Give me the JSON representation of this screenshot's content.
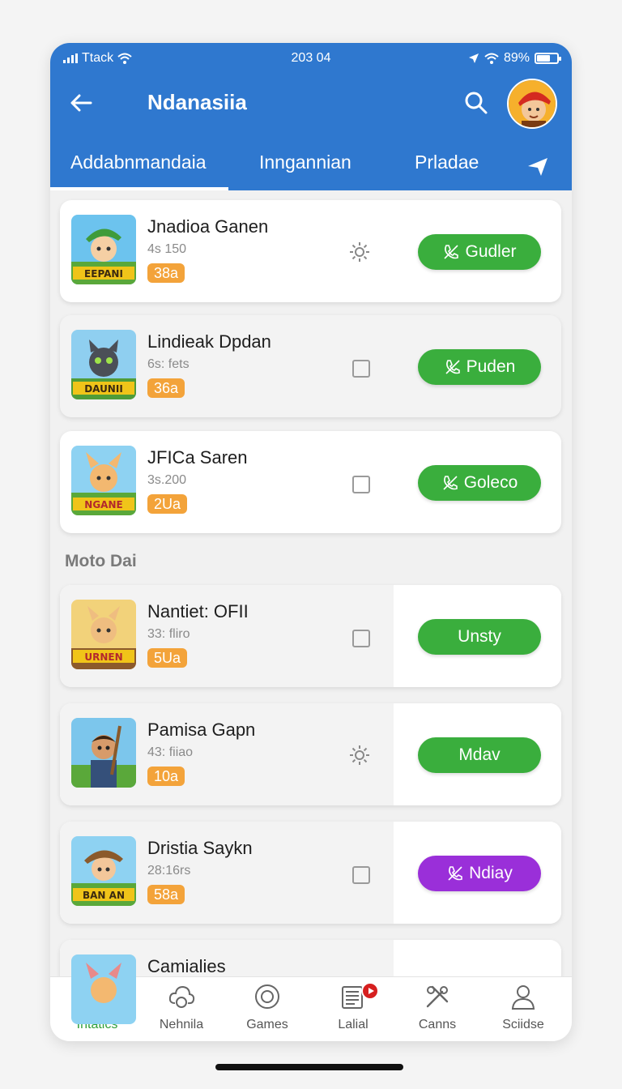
{
  "status_bar": {
    "carrier": "Ttack",
    "time": "203 04",
    "battery": "89%"
  },
  "app_bar": {
    "title": "Ndanasiia"
  },
  "tabs": [
    {
      "label": "Addabnmandaia",
      "active": true
    },
    {
      "label": "Inngannian"
    },
    {
      "label": "Prladae"
    }
  ],
  "games": [
    {
      "title": "Jnadioa Ganen",
      "meta": "4s 150",
      "badge": "38a",
      "control": "gear",
      "button": "Gudler",
      "button_color": "#3aae3d",
      "thumb_text": "EEPANI"
    },
    {
      "title": "Lindieak Dpdan",
      "meta": "6s: fets",
      "badge": "36a",
      "control": "checkbox",
      "button": "Puden",
      "button_color": "#3aae3d",
      "thumb_text": "DAUNII"
    },
    {
      "title": "JFICa Saren",
      "meta": "3s.200",
      "badge": "2Ua",
      "control": "checkbox",
      "button": "Goleco",
      "button_color": "#3aae3d",
      "thumb_text": "NGANE"
    }
  ],
  "section_label": "Moto Dai",
  "more_games": [
    {
      "title": "Nantiet: OFII",
      "meta": "33: fliro",
      "badge": "5Ua",
      "control": "checkbox",
      "button": "Unsty",
      "button_color": "#3aae3d",
      "thumb_text": "URNEN"
    },
    {
      "title": "Pamisa Gapn",
      "meta": "43: fiiao",
      "badge": "10a",
      "control": "gear",
      "button": "Mdav",
      "button_color": "#3aae3d",
      "thumb_text": ""
    },
    {
      "title": "Dristia Saykn",
      "meta": "28:16rs",
      "badge": "58a",
      "control": "checkbox",
      "button": "Ndiay",
      "button_color": "#9a2fd9",
      "thumb_text": "BAN AN"
    },
    {
      "title": "Camialies"
    }
  ],
  "bottom_nav": [
    {
      "label": "Intatics",
      "icon": "home-icon",
      "active": true
    },
    {
      "label": "Nehnila",
      "icon": "cloud-icon"
    },
    {
      "label": "Games",
      "icon": "circle-icon"
    },
    {
      "label": "Lalial",
      "icon": "news-icon",
      "badge": "play-badge"
    },
    {
      "label": "Canns",
      "icon": "tools-icon"
    },
    {
      "label": "Sciidse",
      "icon": "user-icon"
    }
  ]
}
